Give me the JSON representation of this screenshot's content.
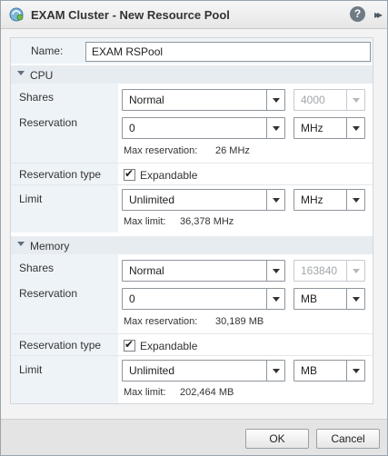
{
  "window": {
    "title": "EXAM Cluster - New Resource Pool",
    "help_glyph": "?",
    "expand_glyph": "▸▸"
  },
  "form": {
    "name": {
      "label": "Name:",
      "value": "EXAM RSPool"
    },
    "cpu": {
      "section_title": "CPU",
      "shares": {
        "label": "Shares",
        "value": "Normal",
        "count": "4000"
      },
      "reservation": {
        "label": "Reservation",
        "value": "0",
        "unit": "MHz",
        "note_label": "Max reservation:",
        "note_value": "26 MHz"
      },
      "reservation_type": {
        "label": "Reservation type",
        "checkbox_label": "Expandable",
        "checked": true
      },
      "limit": {
        "label": "Limit",
        "value": "Unlimited",
        "unit": "MHz",
        "note_label": "Max limit:",
        "note_value": "36,378 MHz"
      }
    },
    "memory": {
      "section_title": "Memory",
      "shares": {
        "label": "Shares",
        "value": "Normal",
        "count": "163840"
      },
      "reservation": {
        "label": "Reservation",
        "value": "0",
        "unit": "MB",
        "note_label": "Max reservation:",
        "note_value": "30,189 MB"
      },
      "reservation_type": {
        "label": "Reservation type",
        "checkbox_label": "Expandable",
        "checked": true
      },
      "limit": {
        "label": "Limit",
        "value": "Unlimited",
        "unit": "MB",
        "note_label": "Max limit:",
        "note_value": "202,464 MB"
      }
    }
  },
  "footer": {
    "ok_label": "OK",
    "cancel_label": "Cancel"
  }
}
